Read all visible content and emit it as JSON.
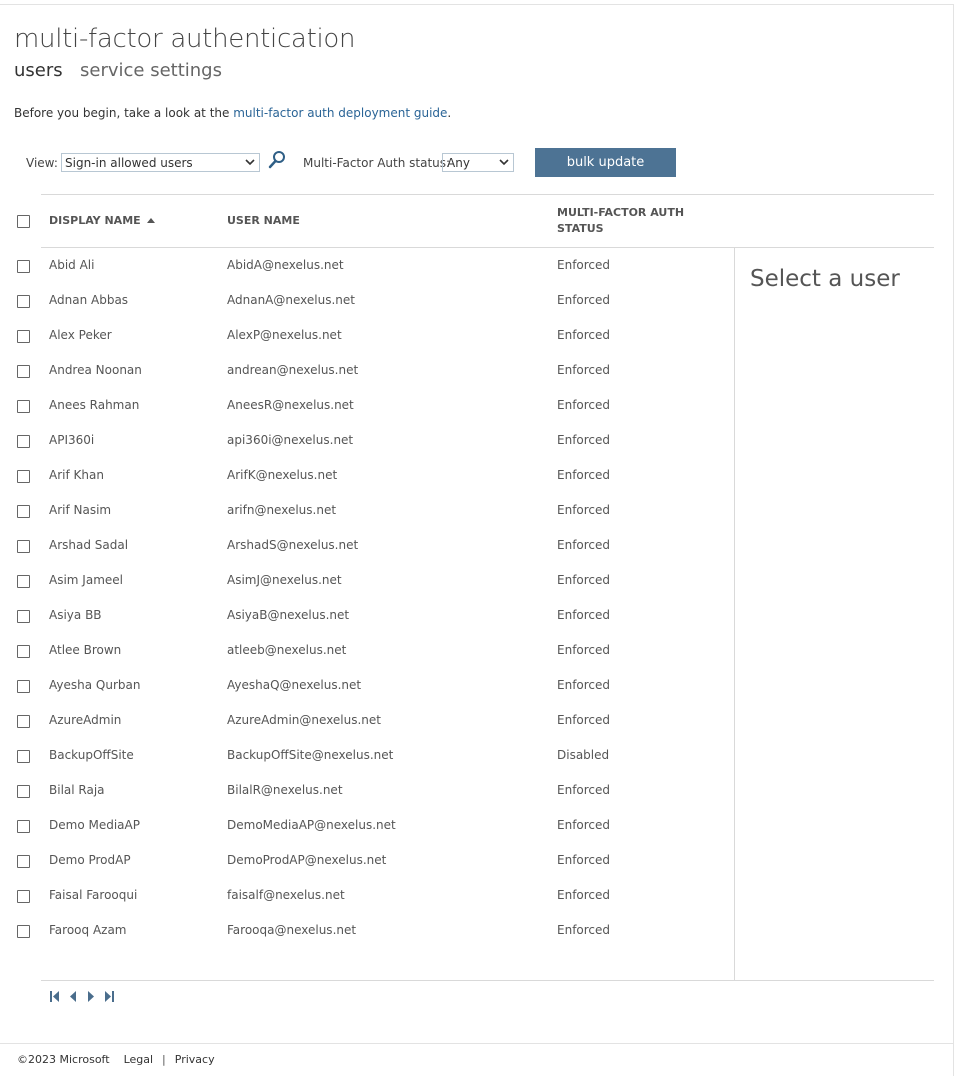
{
  "header": {
    "title": "multi-factor authentication",
    "tabs": [
      {
        "label": "users",
        "active": true
      },
      {
        "label": "service settings",
        "active": false
      }
    ]
  },
  "intro": {
    "prefix": "Before you begin, take a look at the ",
    "link": "multi-factor auth deployment guide",
    "suffix": "."
  },
  "filters": {
    "view_label": "View:",
    "view_value": "Sign-in allowed users",
    "search_icon": "search-icon",
    "mfa_label": "Multi-Factor Auth status:",
    "mfa_value": "Any",
    "bulk_label": "bulk update"
  },
  "table": {
    "headers": {
      "display_name": "DISPLAY NAME",
      "user_name": "USER NAME",
      "mfa_status_line1": "MULTI-FACTOR AUTH",
      "mfa_status_line2": "STATUS"
    },
    "sort": {
      "column": "display_name",
      "direction": "ascending"
    },
    "rows": [
      {
        "name": "Abid Ali",
        "user": "AbidA@nexelus.net",
        "status": "Enforced"
      },
      {
        "name": "Adnan Abbas",
        "user": "AdnanA@nexelus.net",
        "status": "Enforced"
      },
      {
        "name": "Alex Peker",
        "user": "AlexP@nexelus.net",
        "status": "Enforced"
      },
      {
        "name": "Andrea Noonan",
        "user": "andrean@nexelus.net",
        "status": "Enforced"
      },
      {
        "name": "Anees Rahman",
        "user": "AneesR@nexelus.net",
        "status": "Enforced"
      },
      {
        "name": "API360i",
        "user": "api360i@nexelus.net",
        "status": "Enforced"
      },
      {
        "name": "Arif Khan",
        "user": "ArifK@nexelus.net",
        "status": "Enforced"
      },
      {
        "name": "Arif Nasim",
        "user": "arifn@nexelus.net",
        "status": "Enforced"
      },
      {
        "name": "Arshad Sadal",
        "user": "ArshadS@nexelus.net",
        "status": "Enforced"
      },
      {
        "name": "Asim Jameel",
        "user": "AsimJ@nexelus.net",
        "status": "Enforced"
      },
      {
        "name": "Asiya BB",
        "user": "AsiyaB@nexelus.net",
        "status": "Enforced"
      },
      {
        "name": "Atlee Brown",
        "user": "atleeb@nexelus.net",
        "status": "Enforced"
      },
      {
        "name": "Ayesha Qurban",
        "user": "AyeshaQ@nexelus.net",
        "status": "Enforced"
      },
      {
        "name": "AzureAdmin",
        "user": "AzureAdmin@nexelus.net",
        "status": "Enforced"
      },
      {
        "name": "BackupOffSite",
        "user": "BackupOffSite@nexelus.net",
        "status": "Disabled"
      },
      {
        "name": "Bilal Raja",
        "user": "BilalR@nexelus.net",
        "status": "Enforced"
      },
      {
        "name": "Demo MediaAP",
        "user": "DemoMediaAP@nexelus.net",
        "status": "Enforced"
      },
      {
        "name": "Demo ProdAP",
        "user": "DemoProdAP@nexelus.net",
        "status": "Enforced"
      },
      {
        "name": "Faisal Farooqui",
        "user": "faisalf@nexelus.net",
        "status": "Enforced"
      },
      {
        "name": "Farooq Azam",
        "user": "Farooqa@nexelus.net",
        "status": "Enforced"
      }
    ]
  },
  "side_panel": {
    "title": "Select a user"
  },
  "pager": {
    "icons": [
      "first-page-icon",
      "previous-page-icon",
      "next-page-icon",
      "last-page-icon"
    ]
  },
  "footer": {
    "copyright": "©2023 Microsoft",
    "legal": "Legal",
    "separator": "|",
    "privacy": "Privacy"
  },
  "colors": {
    "button_bg": "#4d7394",
    "link": "#2a6496",
    "border": "#d9d9d9"
  }
}
